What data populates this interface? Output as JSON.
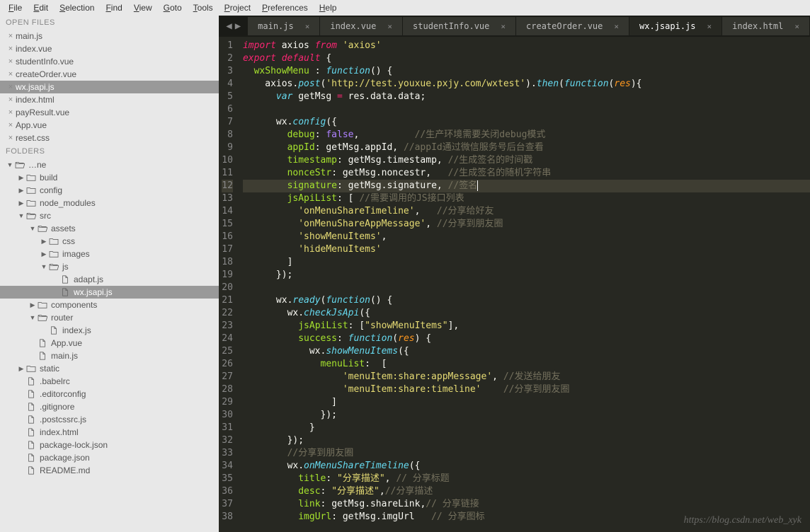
{
  "menubar": {
    "items": [
      "File",
      "Edit",
      "Selection",
      "Find",
      "View",
      "Goto",
      "Tools",
      "Project",
      "Preferences",
      "Help"
    ]
  },
  "sidebar": {
    "open_files_header": "OPEN FILES",
    "folders_header": "FOLDERS",
    "open_files": [
      {
        "name": "main.js",
        "close": true
      },
      {
        "name": "index.vue",
        "close": true
      },
      {
        "name": "studentInfo.vue",
        "close": true
      },
      {
        "name": "createOrder.vue",
        "close": true
      },
      {
        "name": "wx.jsapi.js",
        "close": true,
        "active": true
      },
      {
        "name": "index.html",
        "close": true
      },
      {
        "name": "payResult.vue",
        "close": true
      },
      {
        "name": "App.vue",
        "close": true
      },
      {
        "name": "reset.css",
        "close": true
      }
    ],
    "tree": [
      {
        "type": "folder",
        "name": "…ne",
        "depth": 0,
        "open": true,
        "partial": true
      },
      {
        "type": "folder",
        "name": "build",
        "depth": 1,
        "open": false
      },
      {
        "type": "folder",
        "name": "config",
        "depth": 1,
        "open": false
      },
      {
        "type": "folder",
        "name": "node_modules",
        "depth": 1,
        "open": false
      },
      {
        "type": "folder",
        "name": "src",
        "depth": 1,
        "open": true
      },
      {
        "type": "folder",
        "name": "assets",
        "depth": 2,
        "open": true
      },
      {
        "type": "folder",
        "name": "css",
        "depth": 3,
        "open": false
      },
      {
        "type": "folder",
        "name": "images",
        "depth": 3,
        "open": false
      },
      {
        "type": "folder",
        "name": "js",
        "depth": 3,
        "open": true
      },
      {
        "type": "file",
        "name": "adapt.js",
        "depth": 4
      },
      {
        "type": "file",
        "name": "wx.jsapi.js",
        "depth": 4,
        "active": true
      },
      {
        "type": "folder",
        "name": "components",
        "depth": 2,
        "open": false
      },
      {
        "type": "folder",
        "name": "router",
        "depth": 2,
        "open": true
      },
      {
        "type": "file",
        "name": "index.js",
        "depth": 3
      },
      {
        "type": "file",
        "name": "App.vue",
        "depth": 2
      },
      {
        "type": "file",
        "name": "main.js",
        "depth": 2
      },
      {
        "type": "folder",
        "name": "static",
        "depth": 1,
        "open": false
      },
      {
        "type": "file",
        "name": ".babelrc",
        "depth": 1
      },
      {
        "type": "file",
        "name": ".editorconfig",
        "depth": 1
      },
      {
        "type": "file",
        "name": ".gitignore",
        "depth": 1
      },
      {
        "type": "file",
        "name": ".postcssrc.js",
        "depth": 1
      },
      {
        "type": "file",
        "name": "index.html",
        "depth": 1
      },
      {
        "type": "file",
        "name": "package-lock.json",
        "depth": 1
      },
      {
        "type": "file",
        "name": "package.json",
        "depth": 1
      },
      {
        "type": "file",
        "name": "README.md",
        "depth": 1
      }
    ]
  },
  "tabs": [
    {
      "label": "main.js"
    },
    {
      "label": "index.vue"
    },
    {
      "label": "studentInfo.vue"
    },
    {
      "label": "createOrder.vue"
    },
    {
      "label": "wx.jsapi.js",
      "active": true
    },
    {
      "label": "index.html"
    }
  ],
  "code": {
    "highlighted_line": 12,
    "lines": [
      {
        "n": 1,
        "html": "<span class='kw'>import</span> <span class='id'>axios</span> <span class='kw'>from</span> <span class='str'>'axios'</span>"
      },
      {
        "n": 2,
        "html": "<span class='kw'>export</span> <span class='kw'>default</span> <span class='pn'>{</span>"
      },
      {
        "n": 3,
        "html": "  <span class='prop'>wxShowMenu</span> <span class='pn'>:</span> <span class='fn'>function</span><span class='pn'>() {</span>"
      },
      {
        "n": 4,
        "html": "    <span class='id'>axios</span><span class='pn'>.</span><span class='fn'>post</span><span class='pn'>(</span><span class='str'>'http://test.youxue.pxjy.com/wxtest'</span><span class='pn'>).</span><span class='fn'>then</span><span class='pn'>(</span><span class='fn'>function</span><span class='pn'>(</span><span class='arg'>res</span><span class='pn'>){</span>"
      },
      {
        "n": 5,
        "html": "      <span class='fn'>var</span> <span class='id'>getMsg</span> <span class='op'>=</span> <span class='id'>res</span><span class='pn'>.</span><span class='id'>data</span><span class='pn'>.</span><span class='id'>data</span><span class='pn'>;</span>"
      },
      {
        "n": 6,
        "html": ""
      },
      {
        "n": 7,
        "html": "      <span class='id'>wx</span><span class='pn'>.</span><span class='fn'>config</span><span class='pn'>({</span>"
      },
      {
        "n": 8,
        "html": "        <span class='prop'>debug</span><span class='pn'>:</span> <span class='const'>false</span><span class='pn'>,</span>          <span class='cm'>//生产环境需要关闭debug模式</span>"
      },
      {
        "n": 9,
        "html": "        <span class='prop'>appId</span><span class='pn'>:</span> <span class='id'>getMsg</span><span class='pn'>.</span><span class='id'>appId</span><span class='pn'>,</span> <span class='cm'>//appId通过微信服务号后台查看</span>"
      },
      {
        "n": 10,
        "html": "        <span class='prop'>timestamp</span><span class='pn'>:</span> <span class='id'>getMsg</span><span class='pn'>.</span><span class='id'>timestamp</span><span class='pn'>,</span> <span class='cm'>//生成签名的时间戳</span>"
      },
      {
        "n": 11,
        "html": "        <span class='prop'>nonceStr</span><span class='pn'>:</span> <span class='id'>getMsg</span><span class='pn'>.</span><span class='id'>noncestr</span><span class='pn'>,</span>   <span class='cm'>//生成签名的随机字符串</span>"
      },
      {
        "n": 12,
        "html": "        <span class='prop'>signature</span><span class='pn'>:</span> <span class='id'>getMsg</span><span class='pn'>.</span><span class='id'>signature</span><span class='pn'>,</span> <span class='cm'>//签名<span class='cursor'></span></span>"
      },
      {
        "n": 13,
        "html": "        <span class='prop'>jsApiList</span><span class='pn'>: [</span> <span class='cm'>//需要调用的JS接口列表</span>"
      },
      {
        "n": 14,
        "html": "          <span class='str'>'onMenuShareTimeline'</span><span class='pn'>,</span>   <span class='cm'>//分享给好友</span>"
      },
      {
        "n": 15,
        "html": "          <span class='str'>'onMenuShareAppMessage'</span><span class='pn'>,</span> <span class='cm'>//分享到朋友圈</span>"
      },
      {
        "n": 16,
        "html": "          <span class='str'>'showMenuItems'</span><span class='pn'>,</span>"
      },
      {
        "n": 17,
        "html": "          <span class='str'>'hideMenuItems'</span>"
      },
      {
        "n": 18,
        "html": "        <span class='pn'>]</span>"
      },
      {
        "n": 19,
        "html": "      <span class='pn'>});</span>"
      },
      {
        "n": 20,
        "html": ""
      },
      {
        "n": 21,
        "html": "      <span class='id'>wx</span><span class='pn'>.</span><span class='fn'>ready</span><span class='pn'>(</span><span class='fn'>function</span><span class='pn'>() {</span>"
      },
      {
        "n": 22,
        "html": "        <span class='id'>wx</span><span class='pn'>.</span><span class='fn'>checkJsApi</span><span class='pn'>({</span>"
      },
      {
        "n": 23,
        "html": "          <span class='prop'>jsApiList</span><span class='pn'>: [</span><span class='str'>\"showMenuItems\"</span><span class='pn'>],</span>"
      },
      {
        "n": 24,
        "html": "          <span class='prop'>success</span><span class='pn'>:</span> <span class='fn'>function</span><span class='pn'>(</span><span class='arg'>res</span><span class='pn'>) {</span>"
      },
      {
        "n": 25,
        "html": "            <span class='id'>wx</span><span class='pn'>.</span><span class='fn'>showMenuItems</span><span class='pn'>({</span>"
      },
      {
        "n": 26,
        "html": "              <span class='prop'>menuList</span><span class='pn'>:  [</span>"
      },
      {
        "n": 27,
        "html": "                  <span class='str'>'menuItem:share:appMessage'</span><span class='pn'>,</span> <span class='cm'>//发送给朋友</span>"
      },
      {
        "n": 28,
        "html": "                  <span class='str'>'menuItem:share:timeline'</span>    <span class='cm'>//分享到朋友圈</span>"
      },
      {
        "n": 29,
        "html": "                <span class='pn'>]</span>"
      },
      {
        "n": 30,
        "html": "              <span class='pn'>});</span>"
      },
      {
        "n": 31,
        "html": "            <span class='pn'>}</span>"
      },
      {
        "n": 32,
        "html": "        <span class='pn'>});</span>"
      },
      {
        "n": 33,
        "html": "        <span class='cm'>//分享到朋友圈</span>"
      },
      {
        "n": 34,
        "html": "        <span class='id'>wx</span><span class='pn'>.</span><span class='fn'>onMenuShareTimeline</span><span class='pn'>({</span>"
      },
      {
        "n": 35,
        "html": "          <span class='prop'>title</span><span class='pn'>:</span> <span class='str'>\"分享描述\"</span><span class='pn'>,</span> <span class='cm'>// 分享标题</span>"
      },
      {
        "n": 36,
        "html": "          <span class='prop'>desc</span><span class='pn'>:</span> <span class='str'>\"分享描述\"</span><span class='pn'>,</span><span class='cm'>//分享描述</span>"
      },
      {
        "n": 37,
        "html": "          <span class='prop'>link</span><span class='pn'>:</span> <span class='id'>getMsg</span><span class='pn'>.</span><span class='id'>shareLink</span><span class='pn'>,</span><span class='cm'>// 分享链接</span>"
      },
      {
        "n": 38,
        "html": "          <span class='prop'>imgUrl</span><span class='pn'>:</span> <span class='id'>getMsg</span><span class='pn'>.</span><span class='id'>imgUrl</span>   <span class='cm'>// 分享图标</span>"
      }
    ]
  },
  "watermark": "https://blog.csdn.net/web_xyk"
}
